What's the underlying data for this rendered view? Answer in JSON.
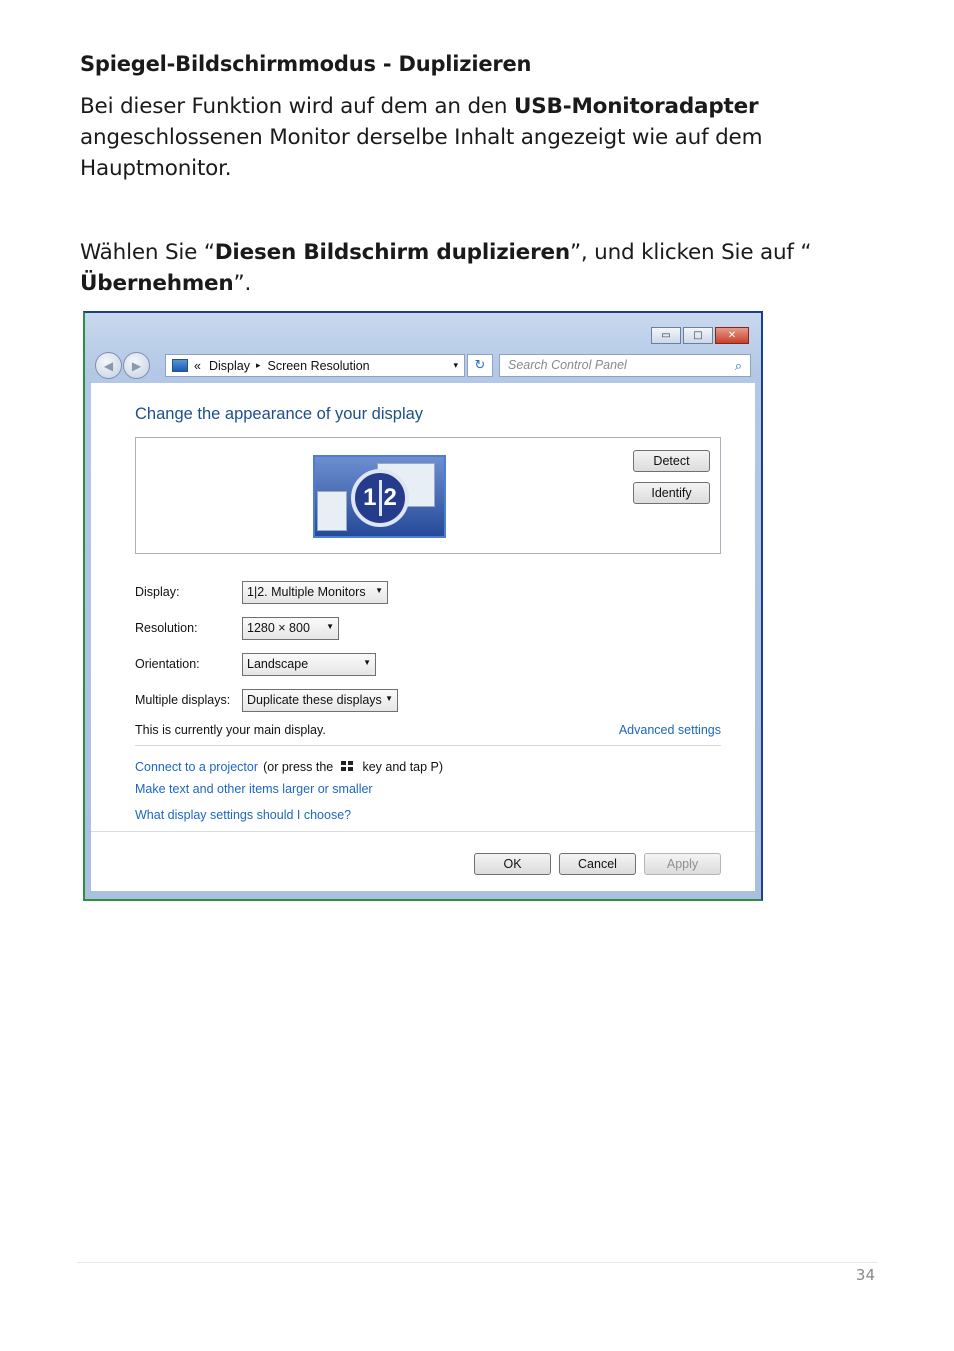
{
  "document": {
    "heading": "Spiegel-Bildschirmmodus - Duplizieren",
    "para1": {
      "before": "Bei dieser Funktion wird auf dem an den ",
      "bold": "USB-Monitoradapter",
      "after": " angeschlossenen Monitor derselbe Inhalt angezeigt wie auf dem Hauptmonitor."
    },
    "para2": {
      "t1": "Wählen Sie “",
      "b1": "Diesen Bildschirm duplizieren",
      "t2": "”, und klicken Sie auf “",
      "b2": "Übernehmen",
      "t3": "”."
    },
    "page_number": "34"
  },
  "window": {
    "controls": {
      "minimize": "▭",
      "maximize": "□",
      "close": "✕"
    },
    "nav": {
      "back_icon": "back-arrow-icon",
      "forward_icon": "forward-arrow-icon"
    },
    "breadcrumb": {
      "chevron": "«",
      "item1": "Display",
      "sep": "▸",
      "item2": "Screen Resolution",
      "dropdown": "▾"
    },
    "refresh": "↻",
    "search_placeholder": "Search Control Panel",
    "search_glyph": "⌕",
    "title": "Change the appearance of your display",
    "monitor_badge": {
      "left": "1",
      "right": "2"
    },
    "detect_label": "Detect",
    "identify_label": "Identify",
    "fields": [
      {
        "label": "Display:",
        "value": "1|2. Multiple Monitors"
      },
      {
        "label": "Resolution:",
        "value": "1280 × 800"
      },
      {
        "label": "Orientation:",
        "value": "Landscape"
      },
      {
        "label": "Multiple displays:",
        "value": "Duplicate these displays"
      }
    ],
    "dropdown_arrow": "▼",
    "status_text": "This is currently your main display.",
    "advanced_link": "Advanced settings",
    "links": {
      "projector": "Connect to a projector",
      "projector_suffix1": "(or press the",
      "projector_suffix2": "key and tap P)",
      "text_size": "Make text and other items larger or smaller",
      "help": "What display settings should I choose?"
    },
    "buttons": {
      "ok": "OK",
      "cancel": "Cancel",
      "apply": "Apply"
    }
  }
}
